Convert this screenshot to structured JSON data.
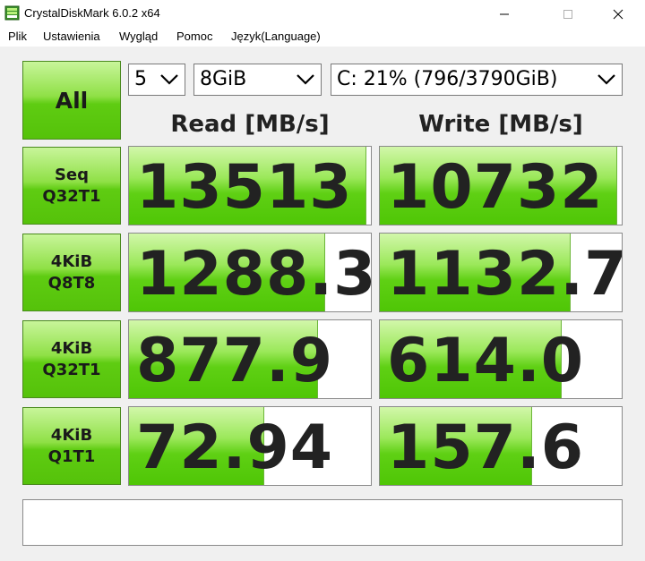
{
  "window": {
    "title": "CrystalDiskMark 6.0.2 x64"
  },
  "menu": [
    {
      "label": "Plik"
    },
    {
      "label": "Ustawienia"
    },
    {
      "label": "Wygląd"
    },
    {
      "label": "Pomoc"
    },
    {
      "label": "Język(Language)"
    }
  ],
  "controls": {
    "all_label": "All",
    "test_count": "5",
    "test_size": "8GiB",
    "drive": "C: 21% (796/3790GiB)"
  },
  "headers": {
    "read": "Read [MB/s]",
    "write": "Write [MB/s]"
  },
  "rows": [
    {
      "label": "Seq\nQ32T1",
      "read": "13513",
      "write": "10732",
      "read_fraction": 0.98,
      "write_fraction": 0.98
    },
    {
      "label": "4KiB\nQ8T8",
      "read": "1288.3",
      "write": "1132.7",
      "read_fraction": 0.81,
      "write_fraction": 0.79
    },
    {
      "label": "4KiB\nQ32T1",
      "read": "877.9",
      "write": "614.0",
      "read_fraction": 0.78,
      "write_fraction": 0.75
    },
    {
      "label": "4KiB\nQ1T1",
      "read": "72.94",
      "write": "157.6",
      "read_fraction": 0.56,
      "write_fraction": 0.63
    }
  ],
  "comment": "",
  "colors": {
    "bar_green": "#5fd014",
    "text": "#222222"
  }
}
